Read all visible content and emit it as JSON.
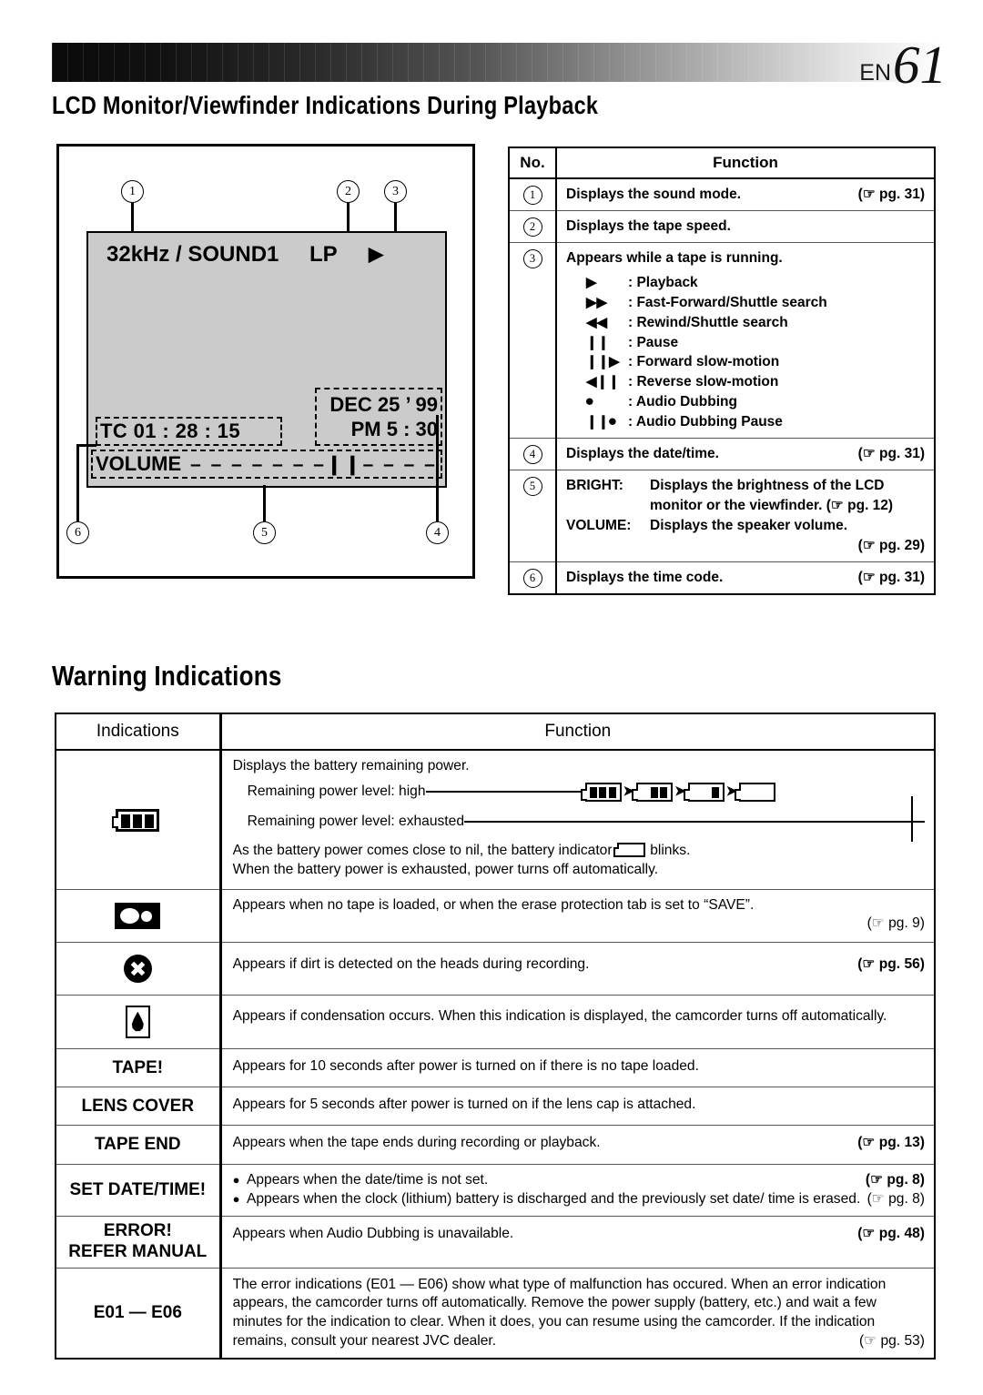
{
  "header": {
    "lang_code": "EN",
    "page_number": "61"
  },
  "sections": {
    "playback_title": "LCD Monitor/Viewfinder Indications During Playback",
    "warning_title": "Warning Indications"
  },
  "lcd_illustration": {
    "sound_mode": "32kHz / SOUND1",
    "tape_speed": "LP",
    "tape_status_symbol": "▶",
    "time_code": "TC  01 : 28 : 15",
    "date": "DEC 25 ’ 99",
    "time": "PM   5 : 30",
    "volume_label": "VOLUME",
    "volume_bar": "–  – – – – – –❙❙– – – – – –  +",
    "callouts": [
      "1",
      "2",
      "3",
      "4",
      "5",
      "6"
    ]
  },
  "number_table": {
    "headers": {
      "no": "No.",
      "function": "Function"
    },
    "rows": [
      {
        "no": "1",
        "text": "Displays the sound mode.",
        "page": "(☞ pg. 31)"
      },
      {
        "no": "2",
        "text": "Displays the tape speed.",
        "page": ""
      },
      {
        "no": "3",
        "text": "Appears while a tape is running.",
        "page": "",
        "symbols": [
          {
            "glyph": "▶",
            "label": ": Playback"
          },
          {
            "glyph": "▶▶",
            "label": ": Fast-Forward/Shuttle search"
          },
          {
            "glyph": "◀◀",
            "label": ": Rewind/Shuttle search"
          },
          {
            "glyph": "❙❙",
            "label": ": Pause"
          },
          {
            "glyph": "❙❙▶",
            "label": ": Forward slow-motion"
          },
          {
            "glyph": "◀❙❙",
            "label": ": Reverse slow-motion"
          },
          {
            "glyph": "⏺",
            "label": ": Audio Dubbing"
          },
          {
            "glyph": "❙❙⏺",
            "label": ": Audio Dubbing Pause"
          }
        ]
      },
      {
        "no": "4",
        "text": "Displays the date/time.",
        "page": "(☞ pg. 31)"
      },
      {
        "no": "5",
        "lines": [
          {
            "label": "BRIGHT:",
            "text": "Displays the brightness of the LCD"
          },
          {
            "label": "",
            "text": "monitor or the viewfinder. (☞ pg. 12)"
          },
          {
            "label": "VOLUME:",
            "text": "Displays the speaker volume."
          },
          {
            "label": "",
            "text": "(☞ pg. 29)"
          }
        ]
      },
      {
        "no": "6",
        "text": "Displays the time code.",
        "page": "(☞ pg. 31)"
      }
    ]
  },
  "warning_table": {
    "headers": {
      "indications": "Indications",
      "function": "Function"
    },
    "rows": [
      {
        "icon": "battery-icon",
        "indication_label": "",
        "intro": "Displays the battery remaining power.",
        "level_high": "Remaining power level: high",
        "level_exhausted": "Remaining power level: exhausted",
        "note_line1_a": "As the battery power comes close to nil, the battery indicator",
        "note_line1_b": "blinks.",
        "note_line2": "When the battery power is exhausted, power turns off automatically.",
        "battery_sequence": [
          "3",
          "2",
          "1",
          "0"
        ]
      },
      {
        "icon": "cassette-tape-icon",
        "indication_label": "",
        "text": "Appears when no tape is loaded, or when the erase protection tab is set to “SAVE”.",
        "page": "(☞ pg. 9)"
      },
      {
        "icon": "dirty-heads-icon",
        "indication_label": "",
        "text": "Appears if dirt is detected on the heads during recording.",
        "page": "(☞ pg. 56)"
      },
      {
        "icon": "condensation-icon",
        "indication_label": "",
        "text": "Appears if condensation occurs. When this indication is displayed, the camcorder turns off automatically.",
        "page": ""
      },
      {
        "icon": "",
        "indication_label": "TAPE!",
        "text": "Appears for 10 seconds after power is turned on if there is no tape loaded.",
        "page": ""
      },
      {
        "icon": "",
        "indication_label": "LENS COVER",
        "text": "Appears for 5 seconds after power is turned on if the lens cap is attached.",
        "page": ""
      },
      {
        "icon": "",
        "indication_label": "TAPE END",
        "text": "Appears when the tape ends during recording or playback.",
        "page": "(☞ pg. 13)"
      },
      {
        "icon": "",
        "indication_label": "SET DATE/TIME!",
        "bullets": [
          {
            "text": "Appears when the date/time is not set.",
            "page": "(☞ pg. 8)"
          },
          {
            "text": "Appears when the clock (lithium) battery is discharged and the previously set date/ time is erased.",
            "page": "(☞ pg. 8)"
          }
        ]
      },
      {
        "icon": "",
        "indication_label": "ERROR!\nREFER MANUAL",
        "indication_line1": "ERROR!",
        "indication_line2": "REFER MANUAL",
        "text": "Appears when Audio Dubbing is unavailable.",
        "page": "(☞ pg. 48)"
      },
      {
        "icon": "",
        "indication_label": "E01 — E06",
        "text": "The error indications (E01 — E06) show what type of malfunction has occured. When an error indication appears, the camcorder turns off automatically. Remove the power supply (battery, etc.) and wait a few minutes for the indication to clear. When it does, you can resume using the camcorder. If the indication remains, consult your nearest JVC dealer.",
        "page": "(☞ pg. 53)"
      }
    ]
  }
}
